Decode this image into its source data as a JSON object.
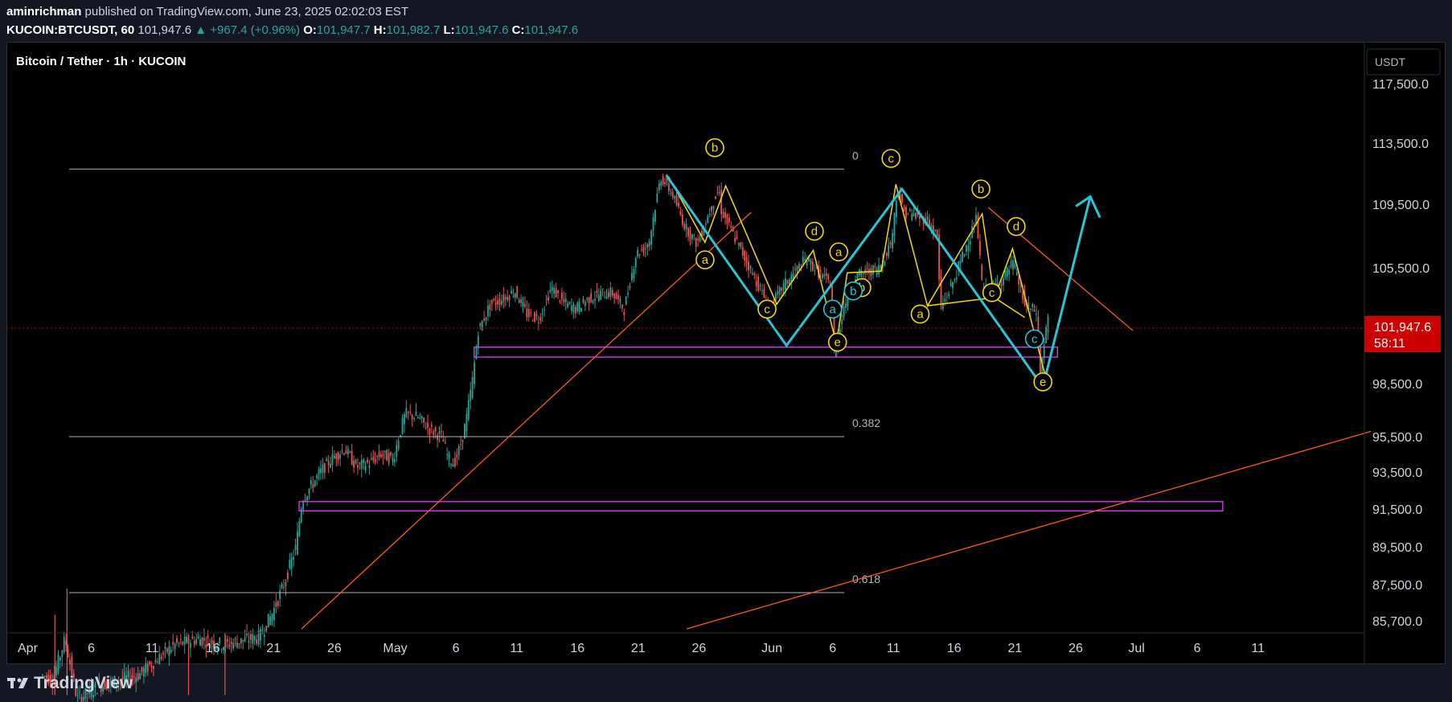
{
  "header": {
    "author": "aminrichman",
    "published_text": "published on TradingView.com, June 23, 2025 02:02:03 EST",
    "symbol": "KUCOIN:BTCUSDT, 60",
    "last": "101,947.6",
    "change": "▲ +967.4 (+0.96%)",
    "o_label": "O:",
    "o_value": "101,947.7",
    "h_label": "H:",
    "h_value": "101,982.7",
    "l_label": "L:",
    "l_value": "101,947.6",
    "c_label": "C:",
    "c_value": "101,947.6"
  },
  "chart_title": "Bitcoin / Tether · 1h · KUCOIN",
  "currency_button": "USDT",
  "price_tag": {
    "price": "101,947.6",
    "countdown": "58:11"
  },
  "footer": {
    "brand": "TradingView",
    "logo_icon": "tradingview-logo-icon"
  },
  "colors": {
    "background": "#000000",
    "bull": "#26a69a",
    "bear": "#ef5350",
    "wave_main": "#26c6da",
    "wave_sub": "#f5d90a",
    "trendline": "#ff5722",
    "zone": "#e040fb",
    "fib": "#b2b5be",
    "price_tag": "#cc0000"
  },
  "chart_data": {
    "type": "candlestick",
    "title": "Bitcoin / Tether · 1h · KUCOIN",
    "ylabels": [
      "117,500.0",
      "113,500.0",
      "109,500.0",
      "105,500.0",
      "98,500.0",
      "95,500.0",
      "93,500.0",
      "91,500.0",
      "89,500.0",
      "87,500.0",
      "85,700.0"
    ],
    "yticks": [
      117500,
      113500,
      109500,
      105500,
      98500,
      95500,
      93500,
      91500,
      89500,
      87500,
      85700
    ],
    "xlabels": [
      {
        "t": 0,
        "label": "Apr"
      },
      {
        "t": 5,
        "label": "6"
      },
      {
        "t": 10,
        "label": "11"
      },
      {
        "t": 15,
        "label": "16"
      },
      {
        "t": 20,
        "label": "21"
      },
      {
        "t": 25,
        "label": "26"
      },
      {
        "t": 30,
        "label": "May"
      },
      {
        "t": 35,
        "label": "6"
      },
      {
        "t": 40,
        "label": "11"
      },
      {
        "t": 45,
        "label": "16"
      },
      {
        "t": 50,
        "label": "21"
      },
      {
        "t": 55,
        "label": "26"
      },
      {
        "t": 61,
        "label": "Jun"
      },
      {
        "t": 66,
        "label": "6"
      },
      {
        "t": 71,
        "label": "11"
      },
      {
        "t": 76,
        "label": "16"
      },
      {
        "t": 81,
        "label": "21"
      },
      {
        "t": 86,
        "label": "26"
      },
      {
        "t": 91,
        "label": "Jul"
      },
      {
        "t": 96,
        "label": "6"
      },
      {
        "t": 101,
        "label": "11"
      }
    ],
    "price_path": [
      [
        1,
        83000
      ],
      [
        2,
        82800
      ],
      [
        3,
        84800
      ],
      [
        4,
        81800
      ],
      [
        6,
        82500
      ],
      [
        9,
        83000
      ],
      [
        12,
        84500
      ],
      [
        14,
        84800
      ],
      [
        16,
        84500
      ],
      [
        19,
        84900
      ],
      [
        20,
        86000
      ],
      [
        21,
        87500
      ],
      [
        22,
        89500
      ],
      [
        22.5,
        92000
      ],
      [
        24,
        93500
      ],
      [
        25,
        94300
      ],
      [
        26,
        94800
      ],
      [
        27,
        93800
      ],
      [
        28,
        94000
      ],
      [
        29,
        94500
      ],
      [
        30,
        94200
      ],
      [
        30.5,
        95600
      ],
      [
        31,
        96800
      ],
      [
        32,
        96600
      ],
      [
        33,
        95900
      ],
      [
        34,
        95500
      ],
      [
        34.5,
        94300
      ],
      [
        35,
        94000
      ],
      [
        35.5,
        94900
      ],
      [
        36,
        96400
      ],
      [
        36.5,
        98600
      ],
      [
        37,
        101700
      ],
      [
        38,
        103300
      ],
      [
        39,
        103600
      ],
      [
        40,
        104100
      ],
      [
        41,
        102700
      ],
      [
        42,
        102400
      ],
      [
        43,
        104300
      ],
      [
        44,
        103400
      ],
      [
        45,
        103000
      ],
      [
        46,
        103600
      ],
      [
        47,
        103900
      ],
      [
        48,
        104000
      ],
      [
        49,
        103000
      ],
      [
        50,
        106400
      ],
      [
        51,
        106900
      ],
      [
        52,
        111300
      ],
      [
        53,
        110100
      ],
      [
        54,
        108100
      ],
      [
        55,
        107000
      ],
      [
        56,
        109000
      ],
      [
        56.8,
        110500
      ],
      [
        57,
        109100
      ],
      [
        59,
        106000
      ],
      [
        60,
        104500
      ],
      [
        61,
        103000
      ],
      [
        62,
        104300
      ],
      [
        64,
        106100
      ],
      [
        65,
        105200
      ],
      [
        66,
        104500
      ],
      [
        66.3,
        100000
      ],
      [
        67,
        103000
      ],
      [
        68,
        105000
      ],
      [
        70,
        105500
      ],
      [
        71,
        107200
      ],
      [
        71.5,
        110500
      ],
      [
        72,
        109000
      ],
      [
        74,
        108500
      ],
      [
        74.8,
        107400
      ],
      [
        75,
        103000
      ],
      [
        76,
        104500
      ],
      [
        78,
        108600
      ],
      [
        78.5,
        104000
      ],
      [
        79,
        104200
      ],
      [
        80,
        104600
      ],
      [
        81,
        105800
      ],
      [
        82,
        103200
      ],
      [
        83,
        102800
      ],
      [
        83.2,
        98800
      ],
      [
        83.8,
        102300
      ]
    ],
    "spikes": [
      [
        2,
        86000
      ],
      [
        3,
        87300
      ],
      [
        13,
        84800
      ],
      [
        16,
        85100
      ]
    ],
    "fib_levels": [
      {
        "label": "0",
        "price": 111800
      },
      {
        "label": "0.382",
        "price": 95500
      },
      {
        "label": "0.618",
        "price": 87100
      }
    ],
    "zones": [
      {
        "t0": 36.5,
        "t1": 84.5,
        "low": 100100,
        "high": 100700
      },
      {
        "t0": 22.1,
        "t1": 98.1,
        "low": 91400,
        "high": 91900
      }
    ],
    "trendlines": [
      {
        "t0": 22.3,
        "p0": 85300,
        "t1": 59.3,
        "p1": 109000
      },
      {
        "t0": 54,
        "p0": 85300,
        "t1": 110.3,
        "p1": 95800
      },
      {
        "t0": 78.8,
        "p0": 109300,
        "t1": 90.7,
        "p1": 101700
      }
    ],
    "wave_main": [
      [
        52.3,
        111400
      ],
      [
        62.2,
        100800
      ],
      [
        71.7,
        110500
      ],
      [
        82.7,
        98900
      ]
    ],
    "projection": [
      [
        83.5,
        98900
      ],
      [
        87.2,
        110000
      ]
    ],
    "wave_sub": [
      [
        52.5,
        111300
      ],
      [
        55.5,
        107100
      ],
      [
        57.2,
        110700
      ],
      [
        61.4,
        103300
      ],
      [
        64.4,
        106600
      ],
      [
        66.3,
        100900
      ],
      [
        67.2,
        105200
      ],
      [
        70,
        105300
      ],
      [
        71.2,
        110800
      ],
      [
        73.8,
        103200
      ],
      [
        78.3,
        108900
      ],
      [
        79.3,
        103700
      ],
      [
        80.8,
        106700
      ],
      [
        83.6,
        98700
      ]
    ],
    "wave_sub_extra": [
      [
        73.8,
        103200
      ],
      [
        79.3,
        103700
      ],
      [
        81.8,
        102500
      ]
    ],
    "wave_labels_main": [
      {
        "t": 67.7,
        "p": 104100,
        "text": "b"
      },
      {
        "t": 82.6,
        "p": 101200,
        "text": "c"
      },
      {
        "t": 66.0,
        "p": 103000,
        "text": "a"
      }
    ],
    "wave_labels_sub": [
      {
        "t": 56.3,
        "p": 113200,
        "text": "b"
      },
      {
        "t": 55.5,
        "p": 106000,
        "text": "a"
      },
      {
        "t": 60.6,
        "p": 103000,
        "text": "c"
      },
      {
        "t": 64.5,
        "p": 107800,
        "text": "d"
      },
      {
        "t": 66.5,
        "p": 106500,
        "text": "a"
      },
      {
        "t": 68.4,
        "p": 104300,
        "text": "b"
      },
      {
        "t": 70.8,
        "p": 112500,
        "text": "c"
      },
      {
        "t": 66.4,
        "p": 101000,
        "text": "e"
      },
      {
        "t": 78.2,
        "p": 110500,
        "text": "b"
      },
      {
        "t": 81.1,
        "p": 108100,
        "text": "d"
      },
      {
        "t": 73.2,
        "p": 102700,
        "text": "a"
      },
      {
        "t": 79.1,
        "p": 104000,
        "text": "c"
      },
      {
        "t": 83.3,
        "p": 98600,
        "text": "e"
      }
    ]
  }
}
